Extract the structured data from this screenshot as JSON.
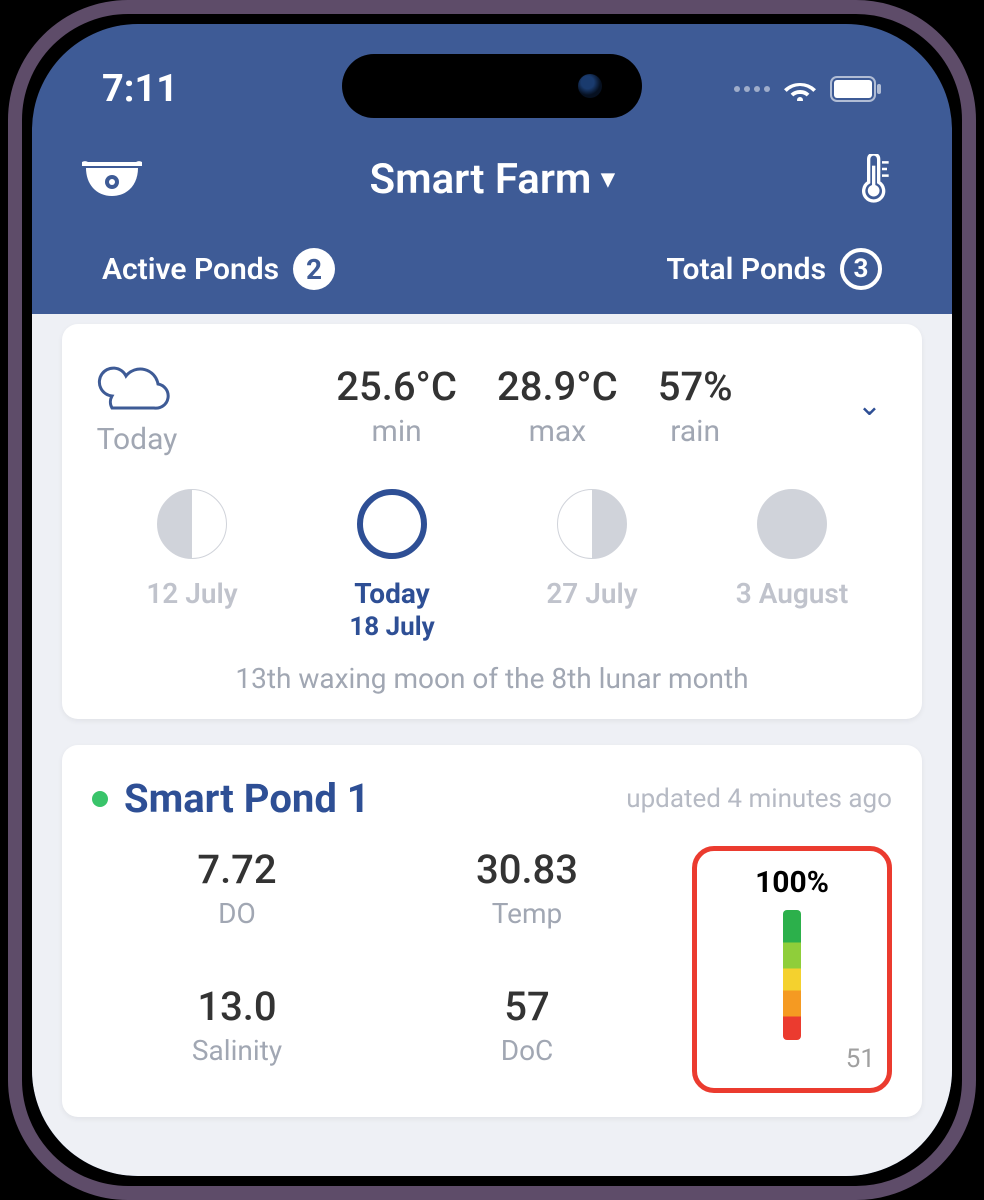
{
  "statusbar": {
    "time": "7:11"
  },
  "header": {
    "title": "Smart Farm"
  },
  "stats": {
    "active_label": "Active Ponds",
    "active_count": "2",
    "total_label": "Total Ponds",
    "total_count": "3"
  },
  "weather": {
    "today_label": "Today",
    "min_val": "25.6°C",
    "min_lab": "min",
    "max_val": "28.9°C",
    "max_lab": "max",
    "rain_val": "57%",
    "rain_lab": "rain"
  },
  "moon": {
    "items": [
      {
        "l1": "12 July",
        "l2": ""
      },
      {
        "l1": "Today",
        "l2": "18 July"
      },
      {
        "l1": "27 July",
        "l2": ""
      },
      {
        "l1": "3 August",
        "l2": ""
      }
    ],
    "desc": "13th waxing moon of the 8th lunar month"
  },
  "pond": {
    "name": "Smart Pond 1",
    "updated": "updated 4 minutes ago",
    "do_v": "7.72",
    "do_l": "DO",
    "temp_v": "30.83",
    "temp_l": "Temp",
    "sal_v": "13.0",
    "sal_l": "Salinity",
    "doc_v": "57",
    "doc_l": "DoC",
    "gauge_top": "100%",
    "gauge_bot": "51"
  }
}
